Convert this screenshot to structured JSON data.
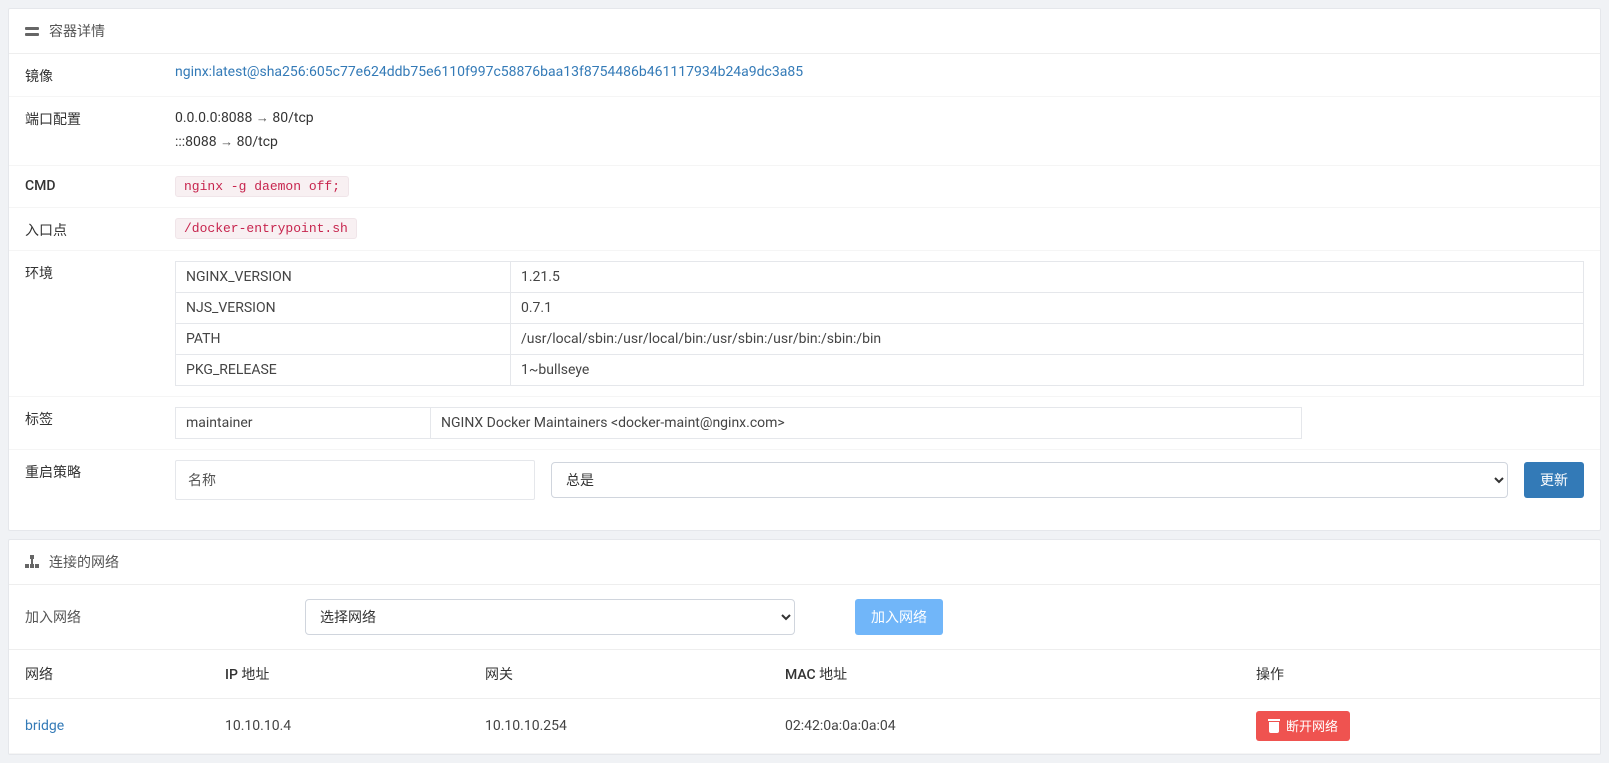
{
  "details": {
    "heading": "容器详情",
    "rows": {
      "image_label": "镜像",
      "image_value": "nginx:latest@sha256:605c77e624ddb75e6110f997c58876baa13f8754486b461117934b24a9dc3a85",
      "ports_label": "端口配置",
      "ports": [
        {
          "host": "0.0.0.0:8088",
          "container": "80/tcp"
        },
        {
          "host": ":::8088",
          "container": "80/tcp"
        }
      ],
      "cmd_label": "CMD",
      "cmd_value": "nginx -g daemon off;",
      "entrypoint_label": "入口点",
      "entrypoint_value": "/docker-entrypoint.sh",
      "env_label": "环境",
      "env": [
        {
          "k": "NGINX_VERSION",
          "v": "1.21.5"
        },
        {
          "k": "NJS_VERSION",
          "v": "0.7.1"
        },
        {
          "k": "PATH",
          "v": "/usr/local/sbin:/usr/local/bin:/usr/sbin:/usr/bin:/sbin:/bin"
        },
        {
          "k": "PKG_RELEASE",
          "v": "1~bullseye"
        }
      ],
      "labels_label": "标签",
      "labels": [
        {
          "k": "maintainer",
          "v": "NGINX Docker Maintainers <docker-maint@nginx.com>"
        }
      ],
      "restart_label": "重启策略",
      "restart_name_label": "名称",
      "restart_selected": "总是",
      "restart_button": "更新"
    }
  },
  "networks": {
    "heading": "连接的网络",
    "join_label": "加入网络",
    "join_select_placeholder": "选择网络",
    "join_button": "加入网络",
    "columns": {
      "network": "网络",
      "ip": "IP 地址",
      "gateway": "网关",
      "mac": "MAC 地址",
      "actions": "操作"
    },
    "rows": [
      {
        "name": "bridge",
        "ip": "10.10.10.4",
        "gateway": "10.10.10.254",
        "mac": "02:42:0a:0a:0a:04",
        "leave_button": "断开网络"
      }
    ]
  }
}
